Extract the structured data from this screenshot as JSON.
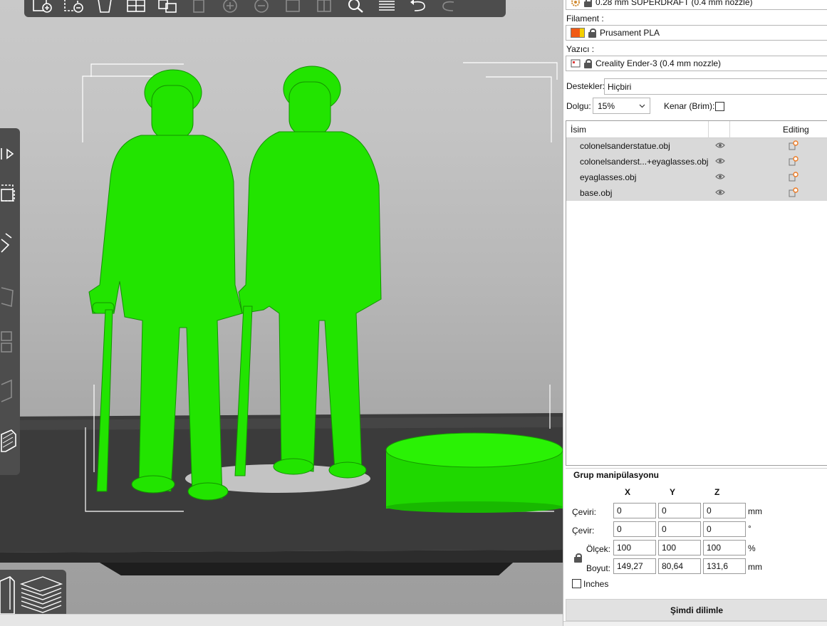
{
  "panel": {
    "print_settings": "0.28 mm SUPERDRAFT (0.4 mm nozzle)",
    "filament_label": "Filament :",
    "filament_value": "Prusament PLA",
    "printer_label": "Yazıcı :",
    "printer_value": "Creality Ender-3 (0.4 mm nozzle)",
    "supports_label": "Destekler:",
    "supports_value": "Hiçbiri",
    "infill_label": "Dolgu:",
    "infill_value": "15%",
    "brim_label": "Kenar (Brim):",
    "object_list": {
      "col_name": "İsim",
      "col_editing": "Editing",
      "rows": [
        {
          "name": "colonelsanderstatue.obj"
        },
        {
          "name": "colonelsanderst...+eyaglasses.obj"
        },
        {
          "name": "eyaglasses.obj"
        },
        {
          "name": "base.obj"
        }
      ]
    },
    "manipulation": {
      "title": "Grup manipülasyonu",
      "axes": [
        "X",
        "Y",
        "Z"
      ],
      "position_label": "Çeviri:",
      "position": [
        "0",
        "0",
        "0"
      ],
      "position_unit": "mm",
      "rotation_label": "Çevir:",
      "rotation": [
        "0",
        "0",
        "0"
      ],
      "rotation_unit": "°",
      "scale_label": "Ölçek:",
      "scale": [
        "100",
        "100",
        "100"
      ],
      "scale_unit": "%",
      "size_label": "Boyut:",
      "size": [
        "149,27",
        "80,64",
        "131,6"
      ],
      "size_unit": "mm",
      "inches_label": "Inches"
    },
    "slice_button": "Şimdi dilimle"
  },
  "colors": {
    "model_green": "#22e400",
    "toolbar": "#4d4d4d",
    "bed": "#3a3a3a",
    "filament_swatch_left": "#f05a14",
    "filament_swatch_right": "#f5d000",
    "edit_accent": "#ee7a22"
  },
  "icons": {
    "settings": "gear-icon",
    "lock": "lock-icon",
    "visibility": "eye-icon",
    "edit": "edit-settings-icon"
  }
}
